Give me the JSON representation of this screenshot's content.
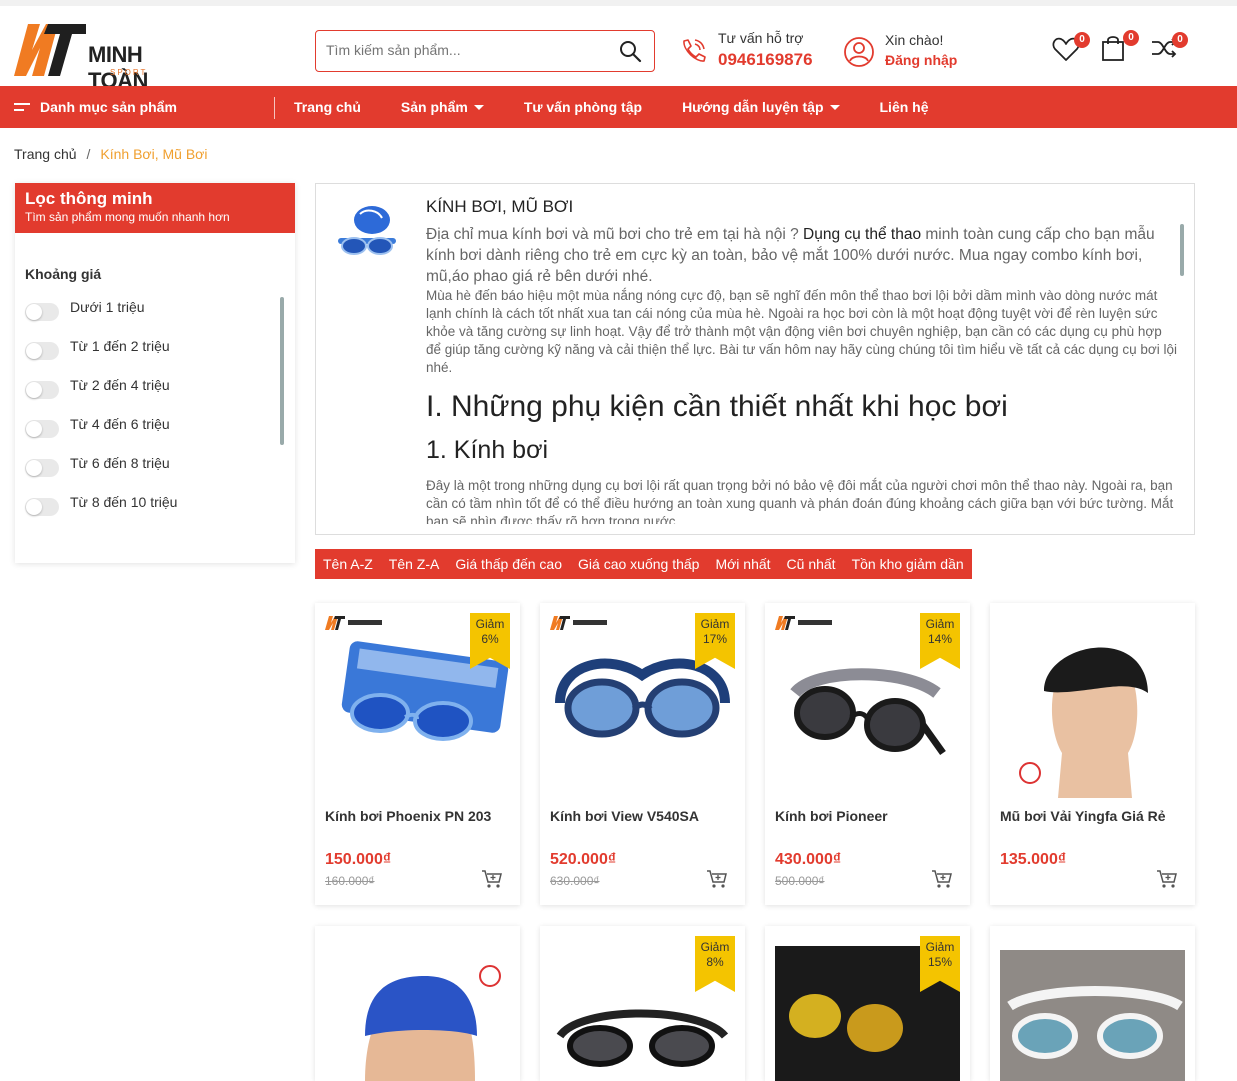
{
  "header": {
    "logo_text": "MINH TOÀN",
    "logo_sub": "SPORT",
    "search_placeholder": "Tìm kiếm sản phẩm...",
    "hotline_label": "Tư vấn hỗ trợ",
    "hotline_phone": "0946169876",
    "account_hello": "Xin chào!",
    "account_login": "Đăng nhập",
    "wishlist_count": "0",
    "cart_count": "0",
    "compare_count": "0"
  },
  "nav": {
    "category": "Danh mục sản phẩm",
    "items": [
      "Trang chủ",
      "Sản phẩm",
      "Tư vấn phòng tập",
      "Hướng dẫn luyện tập",
      "Liên hệ"
    ]
  },
  "breadcrumb": {
    "home": "Trang chủ",
    "sep": "/",
    "current": "Kính Bơi, Mũ Bơi"
  },
  "sidebar": {
    "title": "Lọc thông minh",
    "subtitle": "Tìm sản phẩm mong muốn nhanh hơn",
    "group": "Khoảng giá",
    "options": [
      "Dưới 1 triệu",
      "Từ 1 đến 2 triệu",
      "Từ 2 đến 4 triệu",
      "Từ 4 đến 6 triệu",
      "Từ 6 đến 8 triệu",
      "Từ 8 đến 10 triệu"
    ]
  },
  "description": {
    "title": "KÍNH BƠI, MŨ BƠI",
    "intro_a": "Địa chỉ mua kính bơi và mũ bơi cho trẻ em tại hà nội ? ",
    "intro_link": "Dụng cụ thể thao",
    "intro_b": " minh toàn cung cấp cho bạn mẫu kính bơi dành riêng cho trẻ em cực kỳ an toàn, bảo vệ mắt 100% dưới nước. Mua ngay combo kính bơi, mũ,áo phao giá rẻ bên dưới nhé.",
    "para1": "Mùa hè đến báo hiệu một mùa nắng nóng cực độ, bạn sẽ nghĩ đến môn thể thao bơi lội bởi dầm mình vào dòng nước mát lạnh chính là cách tốt nhất xua tan cái nóng của mùa hè. Ngoài ra học bơi còn là một hoạt động tuyệt vời để rèn luyện sức khỏe và tăng cường sự linh hoạt. Vậy để trở thành một vận động viên bơi chuyên nghiệp, bạn cần có các dụng cụ phù hợp để giúp tăng cường kỹ năng và cải thiện thể lực. Bài tư vấn hôm nay hãy cùng chúng tôi tìm hiểu về tất cả các dụng cụ bơi lội nhé.",
    "heading1": "I. Những phụ kiện cần thiết nhất khi học bơi",
    "heading2": "1. Kính bơi",
    "para2": "Đây là một trong những dụng cụ bơi lội rất quan trọng bởi nó bảo vệ đôi mắt của người chơi môn thể thao này. Ngoài ra, bạn cần có tầm nhìn tốt để có thể điều hướng an toàn xung quanh và phán đoán đúng khoảng cách giữa bạn với bức tường. Mắt bạn sẽ nhìn được thấy rõ hơn trong nước."
  },
  "sort": [
    "Tên A-Z",
    "Tên Z-A",
    "Giá thấp đến cao",
    "Giá cao xuống thấp",
    "Mới nhất",
    "Cũ nhất",
    "Tồn kho giảm dần"
  ],
  "products": [
    {
      "name": "Kính bơi Phoenix PN 203",
      "price": "150.000₫",
      "old_price": "160.000₫",
      "discount_label": "Giảm",
      "discount": "6%"
    },
    {
      "name": "Kính bơi View V540SA",
      "price": "520.000₫",
      "old_price": "630.000₫",
      "discount_label": "Giảm",
      "discount": "17%"
    },
    {
      "name": "Kính bơi Pioneer",
      "price": "430.000₫",
      "old_price": "500.000₫",
      "discount_label": "Giảm",
      "discount": "14%"
    },
    {
      "name": "Mũ bơi Vải Yingfa Giá Rẻ",
      "price": "135.000₫",
      "old_price": "",
      "discount_label": "",
      "discount": ""
    },
    {
      "name": "",
      "price": "",
      "old_price": "",
      "discount_label": "",
      "discount": ""
    },
    {
      "name": "",
      "price": "",
      "old_price": "",
      "discount_label": "Giảm",
      "discount": "8%"
    },
    {
      "name": "",
      "price": "",
      "old_price": "",
      "discount_label": "Giảm",
      "discount": "15%"
    },
    {
      "name": "",
      "price": "",
      "old_price": "",
      "discount_label": "",
      "discount": ""
    }
  ],
  "colors": {
    "brand_red": "#e23b2e",
    "ribbon_yellow": "#f4c400",
    "logo_orange": "#f07b22"
  }
}
